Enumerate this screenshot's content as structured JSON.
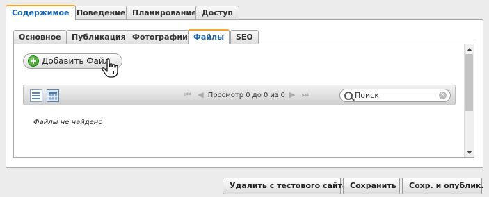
{
  "main_tabs": [
    {
      "label": "Содержимое",
      "active": true
    },
    {
      "label": "Поведение",
      "active": false
    },
    {
      "label": "Планирование",
      "active": false
    },
    {
      "label": "Доступ",
      "active": false
    }
  ],
  "sub_tabs": [
    {
      "label": "Основное",
      "active": false
    },
    {
      "label": "Публикация",
      "active": false
    },
    {
      "label": "Фотографии",
      "active": false
    },
    {
      "label": "Файлы",
      "active": true
    },
    {
      "label": "SEO",
      "active": false
    }
  ],
  "files_panel": {
    "add_button_label": "Добавить Файл",
    "add_button_icon": "add-circle-icon",
    "pager": {
      "status_text": "Просмотр 0 до 0 из 0"
    },
    "search": {
      "value": "Поиск"
    },
    "view_modes": [
      "list-view-icon",
      "grid-view-icon"
    ],
    "empty_message": "Файлы не найдено"
  },
  "footer_buttons": {
    "delete_label": "Удалить с тестового сайта",
    "save_label": "Сохранить",
    "save_publish_label": "Сохр. и опублик."
  },
  "colors": {
    "active_tab_text": "#1a63a8",
    "active_tab_top": "#f0a72b",
    "add_icon": "#2f8e1e"
  }
}
